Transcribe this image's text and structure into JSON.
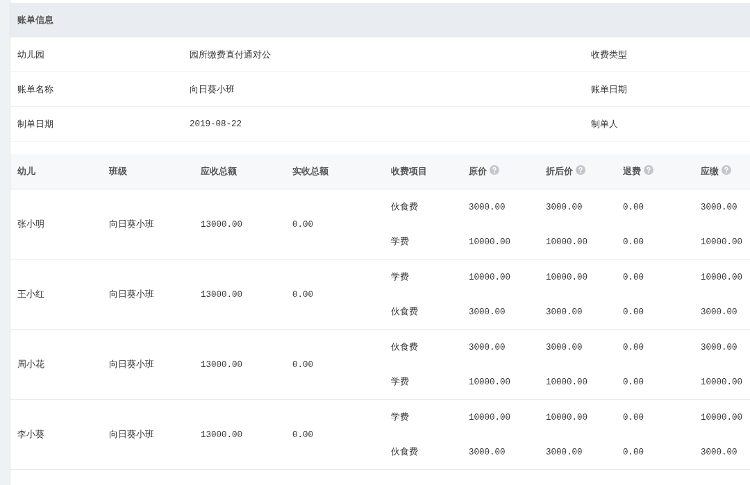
{
  "section": {
    "title": "账单信息"
  },
  "info_rows": [
    {
      "label": "幼儿园",
      "value": "园所缴费直付通对公",
      "label_2": "收费类型"
    },
    {
      "label": "账单名称",
      "value": "向日葵小班",
      "label_2": "账单日期"
    },
    {
      "label": "制单日期",
      "value": "2019-08-22",
      "label_2": "制单人"
    }
  ],
  "table": {
    "columns": [
      {
        "label": "幼儿",
        "help": false
      },
      {
        "label": "班级",
        "help": false
      },
      {
        "label": "应收总额",
        "help": false
      },
      {
        "label": "实收总额",
        "help": false
      },
      {
        "label": "收费项目",
        "help": false
      },
      {
        "label": "原价",
        "help": true
      },
      {
        "label": "折后价",
        "help": true
      },
      {
        "label": "退费",
        "help": true
      },
      {
        "label": "应缴",
        "help": true
      }
    ],
    "rows": [
      {
        "child": "张小明",
        "class": "向日葵小班",
        "receivable_total": "13000.00",
        "received_total": "0.00",
        "items": [
          {
            "name": "伙食费",
            "original_price": "3000.00",
            "discounted_price": "3000.00",
            "refund": "0.00",
            "payable": "3000.00"
          },
          {
            "name": "学费",
            "original_price": "10000.00",
            "discounted_price": "10000.00",
            "refund": "0.00",
            "payable": "10000.00"
          }
        ]
      },
      {
        "child": "王小红",
        "class": "向日葵小班",
        "receivable_total": "13000.00",
        "received_total": "0.00",
        "items": [
          {
            "name": "学费",
            "original_price": "10000.00",
            "discounted_price": "10000.00",
            "refund": "0.00",
            "payable": "10000.00"
          },
          {
            "name": "伙食费",
            "original_price": "3000.00",
            "discounted_price": "3000.00",
            "refund": "0.00",
            "payable": "3000.00"
          }
        ]
      },
      {
        "child": "周小花",
        "class": "向日葵小班",
        "receivable_total": "13000.00",
        "received_total": "0.00",
        "items": [
          {
            "name": "伙食费",
            "original_price": "3000.00",
            "discounted_price": "3000.00",
            "refund": "0.00",
            "payable": "3000.00"
          },
          {
            "name": "学费",
            "original_price": "10000.00",
            "discounted_price": "10000.00",
            "refund": "0.00",
            "payable": "10000.00"
          }
        ]
      },
      {
        "child": "李小葵",
        "class": "向日葵小班",
        "receivable_total": "13000.00",
        "received_total": "0.00",
        "items": [
          {
            "name": "学费",
            "original_price": "10000.00",
            "discounted_price": "10000.00",
            "refund": "0.00",
            "payable": "10000.00"
          },
          {
            "name": "伙食费",
            "original_price": "3000.00",
            "discounted_price": "3000.00",
            "refund": "0.00",
            "payable": "3000.00"
          }
        ]
      }
    ]
  }
}
